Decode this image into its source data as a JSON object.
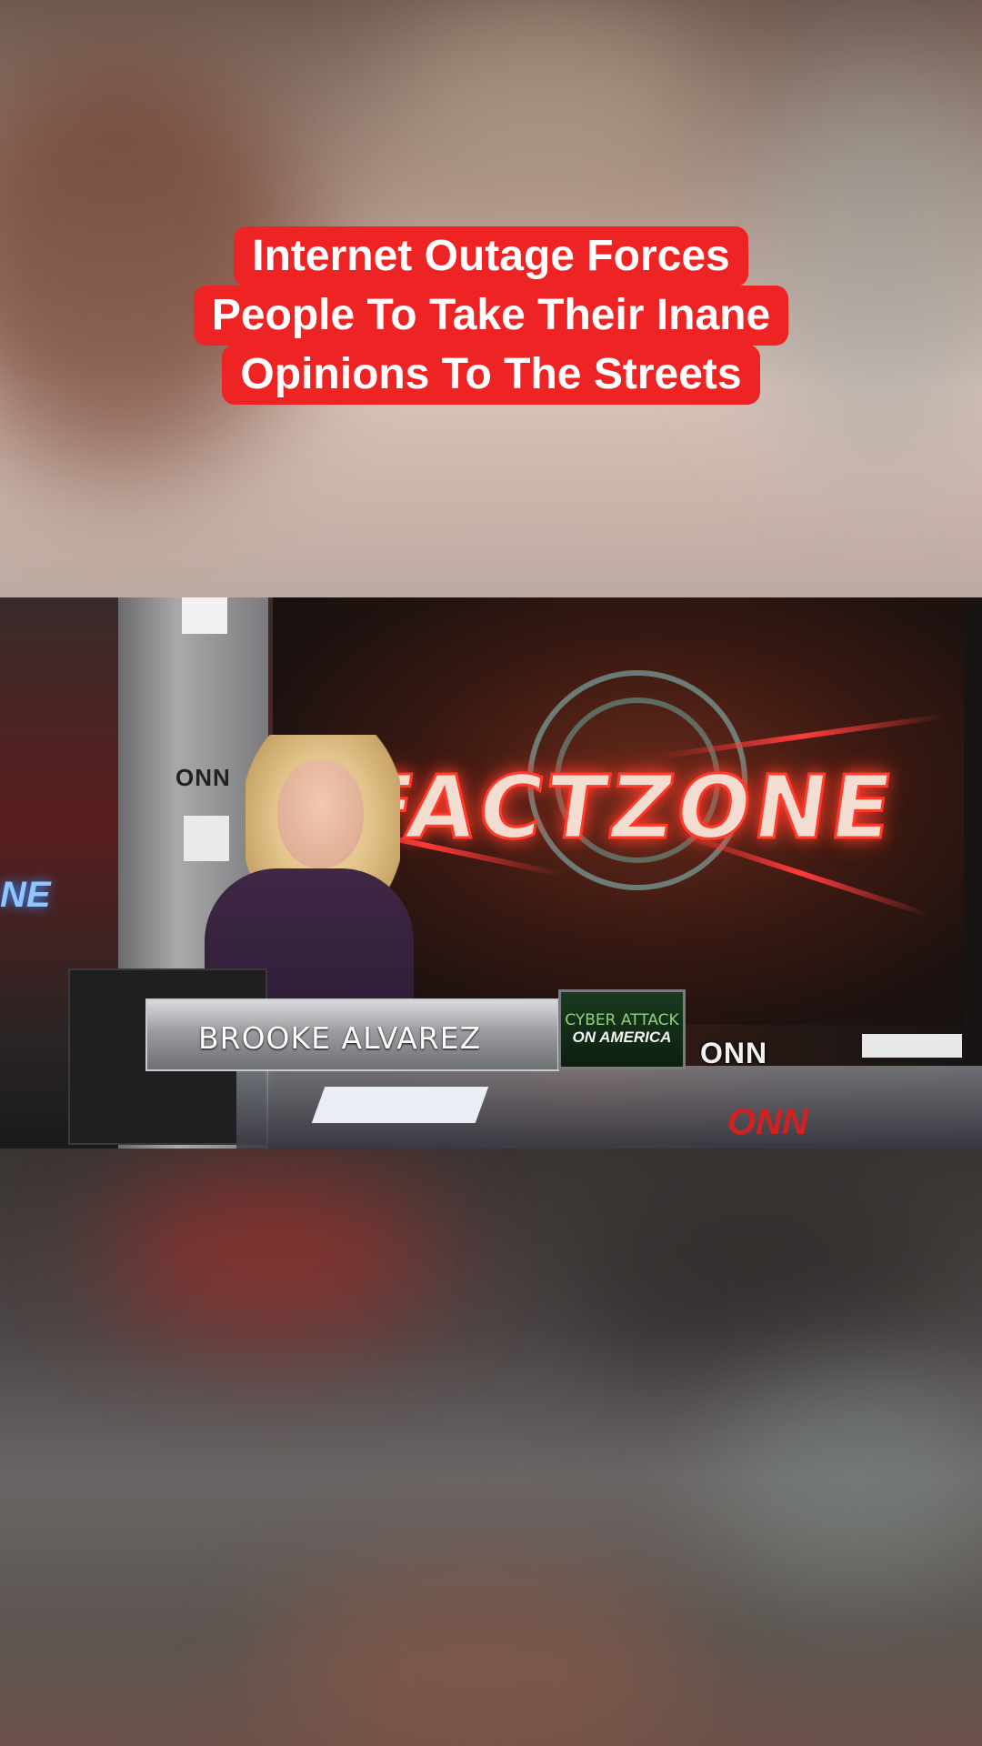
{
  "caption": {
    "lines": [
      "Internet Outage Forces",
      "People To Take Their Inane",
      "Opinions To The Streets"
    ],
    "background_color": "#ee2424",
    "text_color": "#ffffff"
  },
  "video": {
    "set_logo": "FACTZONE",
    "set_logo_partial": "NE",
    "network_logo": "ONN",
    "anchor_name": "BROOKE ALVAREZ",
    "segment_box": {
      "line1": "CYBER ATTACK",
      "line2": "ON AMERICA"
    }
  }
}
